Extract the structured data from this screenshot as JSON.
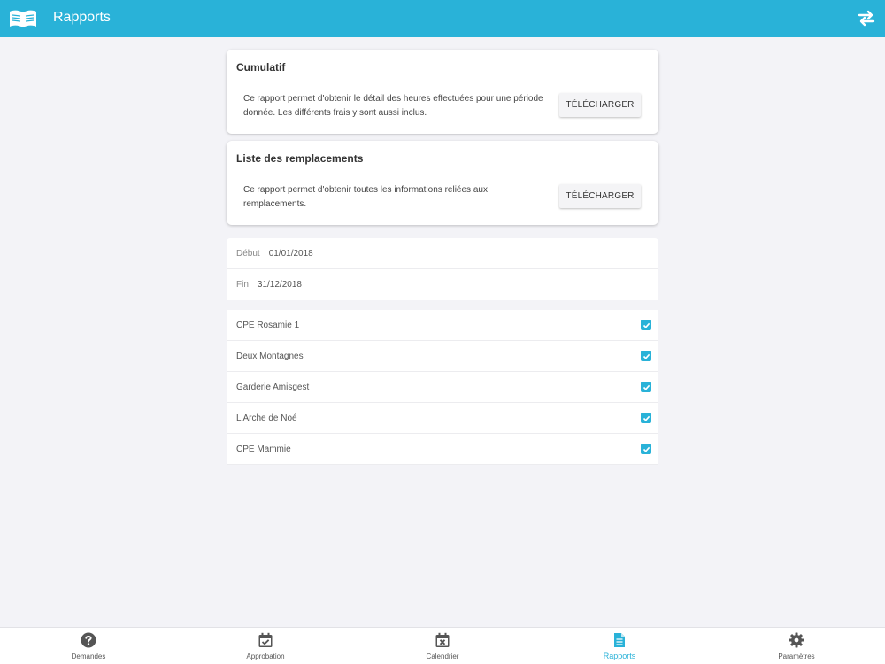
{
  "header": {
    "title": "Rapports",
    "logo_icon": "book-icon",
    "swap_icon": "swap-arrows-icon",
    "color": "#29b2d8"
  },
  "reports": [
    {
      "title": "Cumulatif",
      "description": "Ce rapport permet d'obtenir le détail des heures effectuées pour une période donnée. Les différents frais y sont aussi inclus.",
      "button": "TÉLÉCHARGER"
    },
    {
      "title": "Liste des remplacements",
      "description": "Ce rapport permet d'obtenir toutes les informations reliées aux remplacements.",
      "button": "TÉLÉCHARGER"
    }
  ],
  "dates": {
    "start_label": "Début",
    "start_value": "01/01/2018",
    "end_label": "Fin",
    "end_value": "31/12/2018"
  },
  "facilities": [
    {
      "name": "CPE Rosamie 1",
      "checked": true
    },
    {
      "name": "Deux Montagnes",
      "checked": true
    },
    {
      "name": "Garderie Amisgest",
      "checked": true
    },
    {
      "name": "L'Arche de Noé",
      "checked": true
    },
    {
      "name": "CPE Mammie",
      "checked": true
    }
  ],
  "tabs": [
    {
      "label": "Demandes",
      "icon": "question-circle-icon"
    },
    {
      "label": "Approbation",
      "icon": "calendar-check-icon"
    },
    {
      "label": "Calendrier",
      "icon": "calendar-x-icon"
    },
    {
      "label": "Rapports",
      "icon": "document-icon",
      "active": true
    },
    {
      "label": "Paramètres",
      "icon": "gear-icon"
    }
  ]
}
